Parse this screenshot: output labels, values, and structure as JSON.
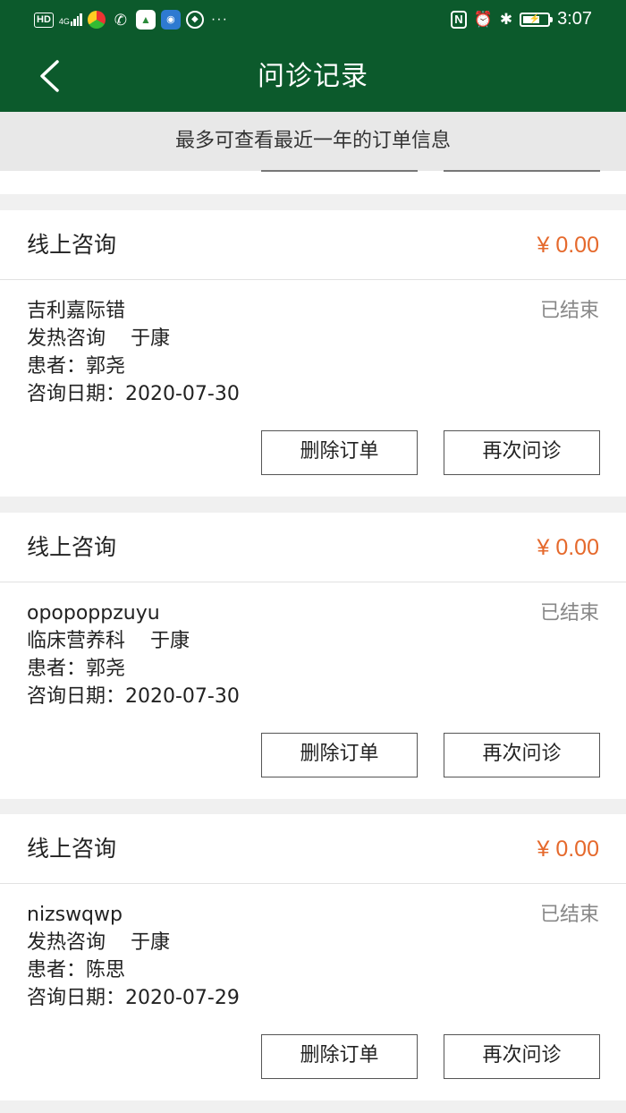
{
  "status_bar": {
    "left": {
      "hd_badge": "HD",
      "network": "4G",
      "app_icons": [
        "chrome-like-icon",
        "phone-wifi-icon",
        "image-app-icon",
        "wifi-hotspot-icon",
        "camera-app-icon"
      ],
      "more": "···"
    },
    "right": {
      "nfc_icon": "N",
      "alarm_icon": "⏰",
      "bluetooth_icon": "✱",
      "time": "3:07"
    }
  },
  "nav": {
    "title": "问诊记录"
  },
  "notice": {
    "text": "最多可查看最近一年的订单信息"
  },
  "cards": [
    {
      "type": "线上咨询",
      "price": "¥ 0.00",
      "name": "吉利嘉际错",
      "status": "已结束",
      "department": "发热咨询",
      "doctor": "于康",
      "patient": "患者：郭尧",
      "date": "咨询日期：2020-07-30",
      "delete_label": "删除订单",
      "again_label": "再次问诊"
    },
    {
      "type": "线上咨询",
      "price": "¥ 0.00",
      "name": "opopoppzuyu",
      "status": "已结束",
      "department": "临床营养科",
      "doctor": "于康",
      "patient": "患者：郭尧",
      "date": "咨询日期：2020-07-30",
      "delete_label": "删除订单",
      "again_label": "再次问诊"
    },
    {
      "type": "线上咨询",
      "price": "¥ 0.00",
      "name": "nizswqwp",
      "status": "已结束",
      "department": "发热咨询",
      "doctor": "于康",
      "patient": "患者：陈思",
      "date": "咨询日期：2020-07-29",
      "delete_label": "删除订单",
      "again_label": "再次问诊"
    }
  ],
  "colors": {
    "primary_green": "#0c5a2c",
    "price_orange": "#e5692c",
    "status_gray": "#888888",
    "page_background": "#f0f0f0"
  }
}
